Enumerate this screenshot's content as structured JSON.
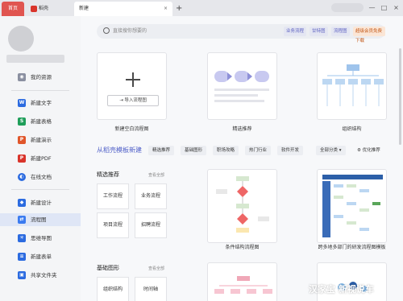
{
  "tabs": {
    "home": "首页",
    "wps": "稻壳",
    "new": "新建",
    "close": "×",
    "add": "+"
  },
  "window": {
    "minimize": "—",
    "maximize": "□",
    "close": "×"
  },
  "sidebar": {
    "items": [
      {
        "label": "我的资源",
        "icon": "resource-icon",
        "color": "#8a8fa0"
      },
      {
        "label": "新建文字",
        "icon": "word-icon",
        "color": "#2c6be0"
      },
      {
        "label": "新建表格",
        "icon": "sheet-icon",
        "color": "#1f9e5a"
      },
      {
        "label": "新建演示",
        "icon": "ppt-icon",
        "color": "#e0562b"
      },
      {
        "label": "新建PDF",
        "icon": "pdf-icon",
        "color": "#d9342b"
      },
      {
        "label": "在线文档",
        "icon": "online-doc-icon",
        "color": "#2c6be0"
      },
      {
        "label": "新建设计",
        "icon": "design-icon",
        "color": "#2c6be0"
      },
      {
        "label": "流程图",
        "icon": "flowchart-icon",
        "color": "#3b7bf0"
      },
      {
        "label": "思维导图",
        "icon": "mindmap-icon",
        "color": "#2c6be0"
      },
      {
        "label": "新建表单",
        "icon": "form-icon",
        "color": "#2c6be0"
      },
      {
        "label": "共享文件夹",
        "icon": "shared-folder-icon",
        "color": "#2c6be0"
      }
    ]
  },
  "search": {
    "placeholder": "直接搜你想要的",
    "tags": [
      "业务流程",
      "甘特图",
      "流程图"
    ],
    "vip": "超级会员免费下载"
  },
  "top_cards": {
    "blank": {
      "label": "新建空白流程图",
      "import": "导入流程图"
    },
    "featured": "精选推荐",
    "org": "组织结构"
  },
  "template_section": {
    "title": "从稻壳模板新建",
    "tabs": [
      "精选推荐",
      "基础图形",
      "职场攻略",
      "热门行业",
      "软件开发",
      "全部分类 ▾"
    ],
    "ai_label": "优化推荐"
  },
  "featured_block": {
    "title": "精选推荐",
    "view_all": "查看全部",
    "items": [
      "工作流程",
      "业务流程",
      "项目流程",
      "招聘流程"
    ]
  },
  "basic_block": {
    "title": "基础图形",
    "view_all": "查看全部",
    "items": [
      "组织结构",
      "时间轴"
    ]
  },
  "template_cards": [
    "条件结构流程图",
    "跨多地多部门的研发流程图模板"
  ],
  "watermark": "汉家宝 新视说车",
  "colors": {
    "accent": "#5060c8",
    "home_tab": "#e05550",
    "active_bg": "#dfe6f6"
  }
}
